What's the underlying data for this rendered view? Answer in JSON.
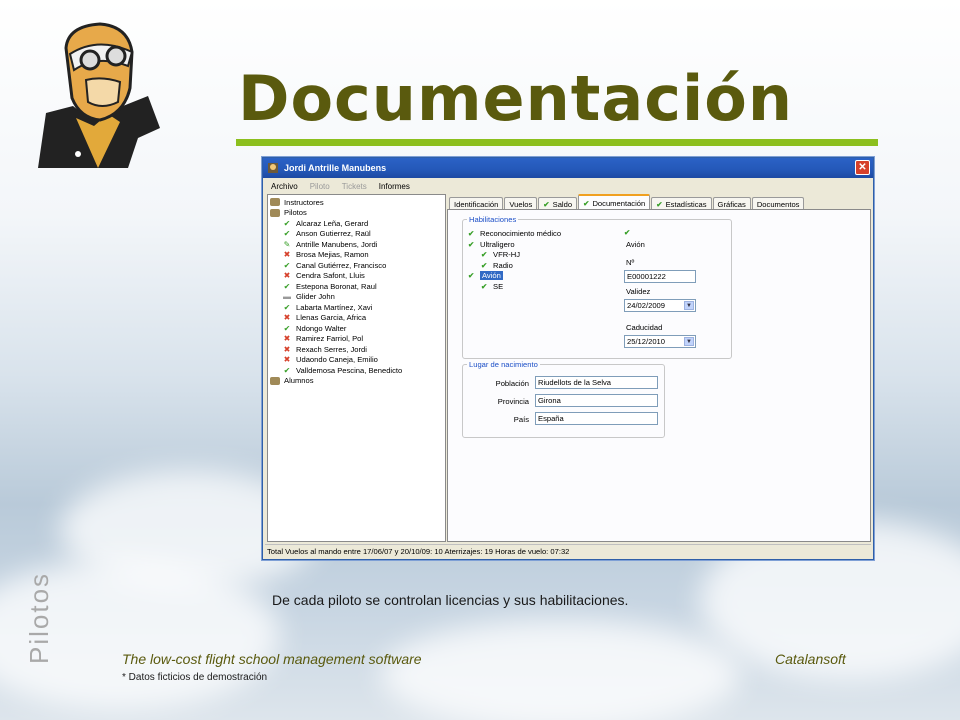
{
  "slide": {
    "title": "Documentación",
    "vertical_label": "Pilotos",
    "caption": "De cada piloto se controlan licencias y sus habilitaciones.",
    "footer_left": "The low-cost flight school management software",
    "footer_right": "Catalansoft",
    "footnote": "* Datos ficticios de demostración"
  },
  "window": {
    "title": "Jordi Antrille Manubens",
    "close_label": "✕",
    "menu": [
      {
        "label": "Archivo",
        "enabled": true
      },
      {
        "label": "Piloto",
        "enabled": false
      },
      {
        "label": "Tickets",
        "enabled": false
      },
      {
        "label": "Informes",
        "enabled": true
      }
    ],
    "tree": {
      "instructores": "Instructores",
      "pilotos": "Pilotos",
      "pilots": [
        {
          "name": "Alcaraz Leña, Gerard",
          "status": "ok"
        },
        {
          "name": "Anson Gutierrez, Raül",
          "status": "ok"
        },
        {
          "name": "Antrille Manubens, Jordi",
          "status": "edit"
        },
        {
          "name": "Brosa Mejias, Ramon",
          "status": "error"
        },
        {
          "name": "Canal Gutiérrez, Francisco",
          "status": "ok"
        },
        {
          "name": "Cendra Safont, Lluis",
          "status": "error"
        },
        {
          "name": "Estepona Boronat, Raul",
          "status": "ok"
        },
        {
          "name": "Glider John",
          "status": "none"
        },
        {
          "name": "Labarta Martínez, Xavi",
          "status": "ok"
        },
        {
          "name": "Llenas Garcia, Africa",
          "status": "error"
        },
        {
          "name": "Ndongo Walter",
          "status": "ok"
        },
        {
          "name": "Ramirez Farriol, Pol",
          "status": "error"
        },
        {
          "name": "Rexach Serres, Jordi",
          "status": "error"
        },
        {
          "name": "Udaondo Caneja, Emilio",
          "status": "error"
        },
        {
          "name": "Valldemosa Pescina, Benedicto",
          "status": "ok"
        }
      ],
      "alumnos": "Alumnos"
    },
    "tabs": [
      {
        "label": "Identificación",
        "check": false,
        "active": false
      },
      {
        "label": "Vuelos",
        "check": false,
        "active": false
      },
      {
        "label": "Saldo",
        "check": true,
        "active": false
      },
      {
        "label": "Documentación",
        "check": true,
        "active": true
      },
      {
        "label": "Estadísticas",
        "check": true,
        "active": false
      },
      {
        "label": "Gráficas",
        "check": false,
        "active": false
      },
      {
        "label": "Documentos",
        "check": false,
        "active": false
      }
    ],
    "habilitaciones": {
      "legend": "Habilitaciones",
      "items": [
        {
          "label": "Reconocimiento médico",
          "level": 0
        },
        {
          "label": "Ultraligero",
          "level": 0
        },
        {
          "label": "VFR-HJ",
          "level": 1
        },
        {
          "label": "Radio",
          "level": 1
        },
        {
          "label": "Avión",
          "level": 0,
          "selected": true
        },
        {
          "label": "SE",
          "level": 1
        }
      ],
      "detail": {
        "type_label": "Avión",
        "number_label": "Nº",
        "number_value": "E00001222",
        "validez_label": "Validez",
        "validez_value": "24/02/2009",
        "caducidad_label": "Caducidad",
        "caducidad_value": "25/12/2010"
      }
    },
    "nacimiento": {
      "legend": "Lugar de nacimiento",
      "poblacion_label": "Población",
      "poblacion_value": "Riudellots de la Selva",
      "provincia_label": "Provincia",
      "provincia_value": "Girona",
      "pais_label": "País",
      "pais_value": "España"
    },
    "status_bar": "Total Vuelos al mando entre 17/06/07 y 20/10/09: 10   Aterrizajes: 19  Horas de vuelo: 07:32"
  },
  "colors": {
    "title": "#5a5a0e",
    "accent_bar": "#8cbf1e",
    "titlebar": "#2458b8",
    "check": "#3aa02a",
    "error": "#d6402a"
  }
}
